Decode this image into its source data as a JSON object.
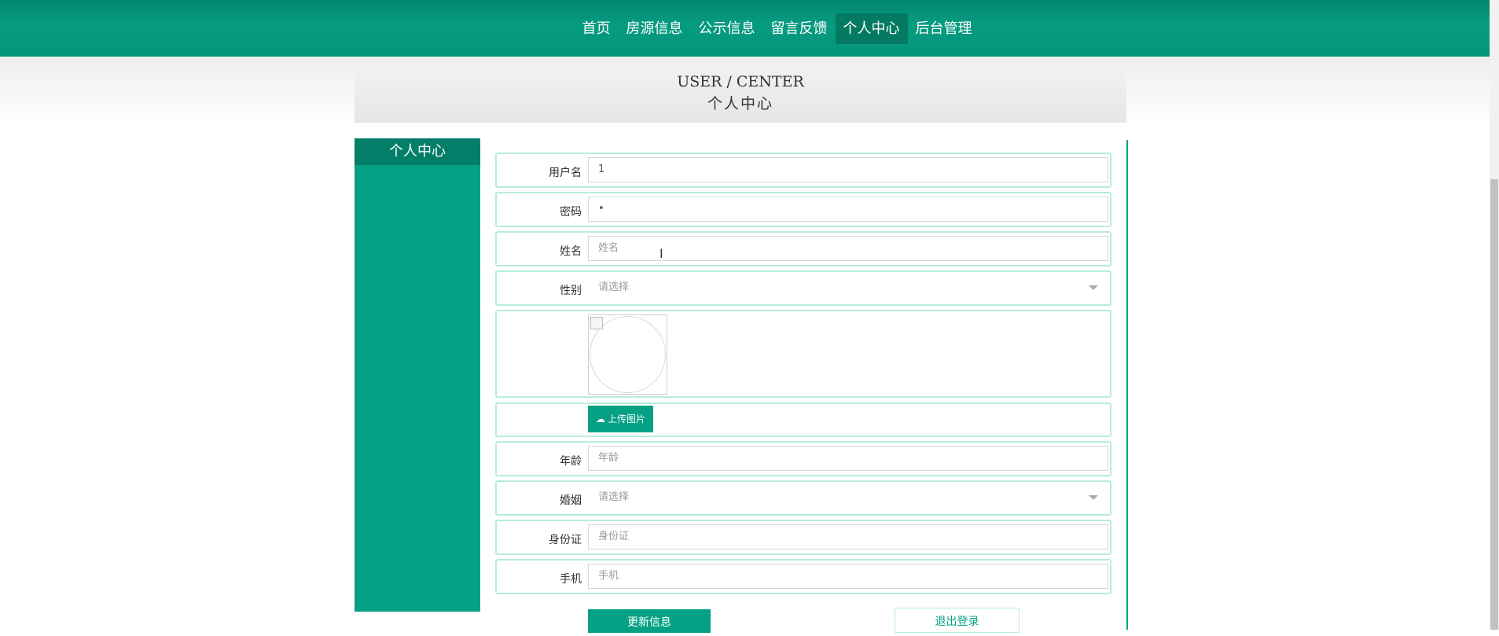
{
  "nav": {
    "items": [
      "首页",
      "房源信息",
      "公示信息",
      "留言反馈",
      "个人中心",
      "后台管理"
    ],
    "active_index": 4
  },
  "banner": {
    "title_en": "USER / CENTER",
    "title_zh": "个人中心"
  },
  "sidebar": {
    "title": "个人中心"
  },
  "form": {
    "username": {
      "label": "用户名",
      "value": "1"
    },
    "password": {
      "label": "密码",
      "value": "•"
    },
    "name": {
      "label": "姓名",
      "placeholder": "姓名"
    },
    "gender": {
      "label": "性别",
      "selected": "请选择"
    },
    "avatar": {
      "upload_label": "上传图片"
    },
    "age": {
      "label": "年龄",
      "placeholder": "年龄"
    },
    "marital": {
      "label": "婚姻",
      "selected": "请选择"
    },
    "id_card": {
      "label": "身份证",
      "placeholder": "身份证"
    },
    "phone": {
      "label": "手机",
      "placeholder": "手机"
    }
  },
  "buttons": {
    "update": "更新信息",
    "logout": "退出登录"
  },
  "icons": {
    "upload": "cloud-upload-icon",
    "select_arrow": "chevron-down-icon",
    "cursor": "text-cursor-icon"
  },
  "colors": {
    "primary": "#04a184",
    "nav_bg": "#069b7f",
    "row_border": "#b6ecdf"
  }
}
